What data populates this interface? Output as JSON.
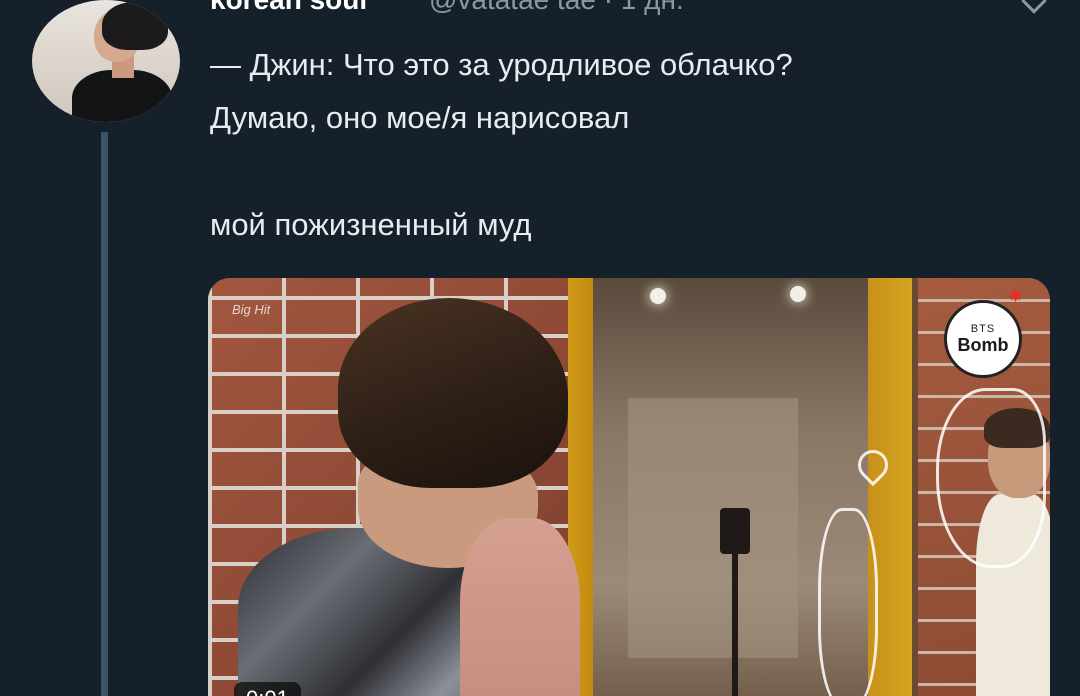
{
  "tweet": {
    "author_name": "korean soul",
    "author_handle": "@vatatae tae · 1 дн.",
    "text_lines": [
      "— Джин: Что это за уродливое облачко?",
      "Думаю, оно мое/я нарисовал",
      "мой пожизненный муд"
    ]
  },
  "media": {
    "watermark": "Big Hit",
    "logo_top": "BTS",
    "logo_bottom": "Bomb",
    "duration": "0:01"
  }
}
